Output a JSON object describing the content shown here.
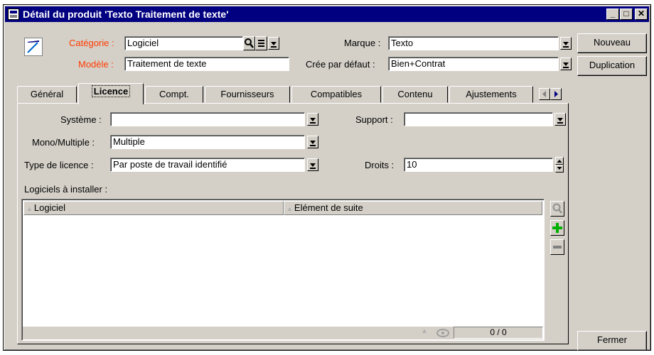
{
  "window": {
    "title": "Détail du produit 'Texto Traitement de texte'",
    "minimize": "_",
    "maximize": "□",
    "close": "✕"
  },
  "header": {
    "categorie_label": "Catégorie :",
    "categorie_value": "Logiciel",
    "modele_label": "Modèle :",
    "modele_value": "Traitement de texte",
    "marque_label": "Marque :",
    "marque_value": "Texto",
    "cree_label": "Crée par défaut :",
    "cree_value": "Bien+Contrat"
  },
  "buttons": {
    "nouveau": "Nouveau",
    "duplication": "Duplication",
    "fermer": "Fermer"
  },
  "tabs": [
    "Général",
    "Licence",
    "Compt.",
    "Fournisseurs",
    "Compatibles",
    "Contenu",
    "Ajustements"
  ],
  "licence": {
    "systeme_label": "Système :",
    "systeme_value": "",
    "support_label": "Support :",
    "support_value": "",
    "mono_label": "Mono/Multiple :",
    "mono_value": "Multiple",
    "type_label": "Type de licence :",
    "type_value": "Par poste de travail identifié",
    "droits_label": "Droits :",
    "droits_value": "10",
    "install_label": "Logiciels à installer :",
    "columns": [
      "Logiciel",
      "Elément de suite"
    ],
    "counter": "0 / 0"
  },
  "colors": {
    "titlebar": "#000080",
    "required_label": "#ff3b00",
    "face": "#d4d0c8"
  }
}
